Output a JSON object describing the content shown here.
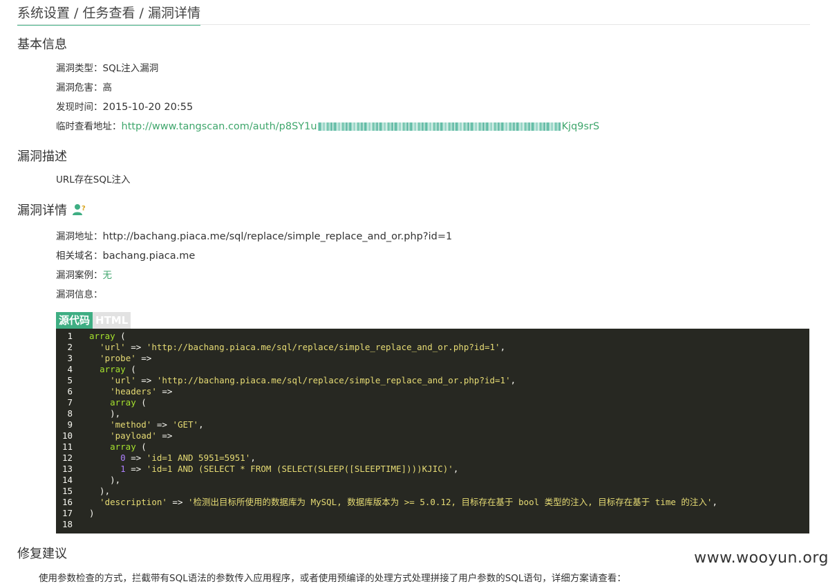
{
  "breadcrumb": {
    "text": "系统设置 / 任务查看 / 漏洞详情"
  },
  "basic_info": {
    "title": "基本信息",
    "type_label": "漏洞类型：",
    "type_value": "SQL注入漏洞",
    "danger_label": "漏洞危害：",
    "danger_value": "高",
    "time_label": "发现时间：",
    "time_value": "2015-10-20 20:55",
    "temp_url_label": "临时查看地址：",
    "temp_url_prefix": "http://www.tangscan.com/auth/p8SY1u",
    "temp_url_suffix": "Kjq9srS"
  },
  "description": {
    "title": "漏洞描述",
    "text": "URL存在SQL注入"
  },
  "details": {
    "title": "漏洞详情",
    "icon": "person-question-icon",
    "url_label": "漏洞地址：",
    "url_value": "http://bachang.piaca.me/sql/replace/simple_replace_and_or.php?id=1",
    "domain_label": "相关域名：",
    "domain_value": "bachang.piaca.me",
    "case_label": "漏洞案例：",
    "case_value": "无",
    "info_label": "漏洞信息："
  },
  "tabs": [
    {
      "label": "源代码",
      "active": true
    },
    {
      "label": "HTML",
      "active": false
    }
  ],
  "code": {
    "lines": [
      [
        {
          "t": "kw",
          "v": "array"
        },
        {
          "t": "op",
          "v": " ("
        }
      ],
      [
        {
          "t": "op",
          "v": "  "
        },
        {
          "t": "str",
          "v": "'url'"
        },
        {
          "t": "op",
          "v": " => "
        },
        {
          "t": "str",
          "v": "'http://bachang.piaca.me/sql/replace/simple_replace_and_or.php?id=1'"
        },
        {
          "t": "op",
          "v": ","
        }
      ],
      [
        {
          "t": "op",
          "v": "  "
        },
        {
          "t": "str",
          "v": "'probe'"
        },
        {
          "t": "op",
          "v": " =>"
        }
      ],
      [
        {
          "t": "op",
          "v": "  "
        },
        {
          "t": "kw",
          "v": "array"
        },
        {
          "t": "op",
          "v": " ("
        }
      ],
      [
        {
          "t": "op",
          "v": "    "
        },
        {
          "t": "str",
          "v": "'url'"
        },
        {
          "t": "op",
          "v": " => "
        },
        {
          "t": "str",
          "v": "'http://bachang.piaca.me/sql/replace/simple_replace_and_or.php?id=1'"
        },
        {
          "t": "op",
          "v": ","
        }
      ],
      [
        {
          "t": "op",
          "v": "    "
        },
        {
          "t": "str",
          "v": "'headers'"
        },
        {
          "t": "op",
          "v": " =>"
        }
      ],
      [
        {
          "t": "op",
          "v": "    "
        },
        {
          "t": "kw",
          "v": "array"
        },
        {
          "t": "op",
          "v": " ("
        }
      ],
      [
        {
          "t": "op",
          "v": "    ),"
        }
      ],
      [
        {
          "t": "op",
          "v": "    "
        },
        {
          "t": "str",
          "v": "'method'"
        },
        {
          "t": "op",
          "v": " => "
        },
        {
          "t": "str",
          "v": "'GET'"
        },
        {
          "t": "op",
          "v": ","
        }
      ],
      [
        {
          "t": "op",
          "v": "    "
        },
        {
          "t": "str",
          "v": "'payload'"
        },
        {
          "t": "op",
          "v": " =>"
        }
      ],
      [
        {
          "t": "op",
          "v": "    "
        },
        {
          "t": "kw",
          "v": "array"
        },
        {
          "t": "op",
          "v": " ("
        }
      ],
      [
        {
          "t": "op",
          "v": "      "
        },
        {
          "t": "num",
          "v": "0"
        },
        {
          "t": "op",
          "v": " => "
        },
        {
          "t": "str",
          "v": "'id=1 AND 5951=5951'"
        },
        {
          "t": "op",
          "v": ","
        }
      ],
      [
        {
          "t": "op",
          "v": "      "
        },
        {
          "t": "num",
          "v": "1"
        },
        {
          "t": "op",
          "v": " => "
        },
        {
          "t": "str",
          "v": "'id=1 AND (SELECT * FROM (SELECT(SLEEP([SLEEPTIME])))KJIC)'"
        },
        {
          "t": "op",
          "v": ","
        }
      ],
      [
        {
          "t": "op",
          "v": "    ),"
        }
      ],
      [
        {
          "t": "op",
          "v": "  ),"
        }
      ],
      [
        {
          "t": "op",
          "v": "  "
        },
        {
          "t": "str",
          "v": "'description'"
        },
        {
          "t": "op",
          "v": " => "
        },
        {
          "t": "str",
          "v": "'检测出目标所使用的数据库为 MySQL, 数据库版本为 >= 5.0.12, 目标存在基于 bool 类型的注入, 目标存在基于 time 的注入'"
        },
        {
          "t": "op",
          "v": ","
        }
      ],
      [
        {
          "t": "op",
          "v": ")"
        }
      ],
      []
    ]
  },
  "fix": {
    "title": "修复建议",
    "text": "使用参数检查的方式，拦截带有SQL语法的参数传入应用程序，或者使用预编译的处理方式处理拼接了用户参数的SQL语句，详细方案请查看："
  },
  "watermark": "www.wooyun.org",
  "colors": {
    "accent": "#3fae83",
    "code_bg": "#272822",
    "link": "#3fa66c"
  }
}
